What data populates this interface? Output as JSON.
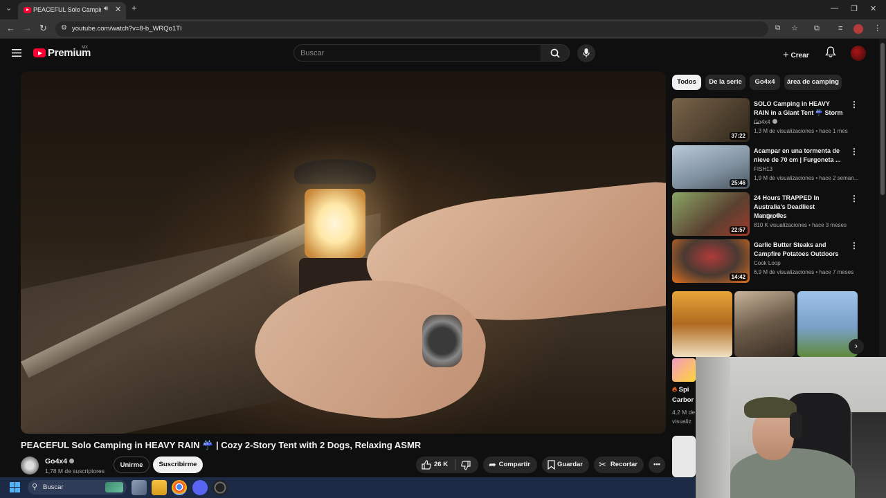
{
  "browser": {
    "tab_title": "PEACEFUL Solo Camping in HEAVY RAIN",
    "url": "youtube.com/watch?v=8-b_WRQo1TI"
  },
  "header": {
    "logo_text": "Premium",
    "country_code": "MX",
    "search_placeholder": "Buscar",
    "create_label": "Crear"
  },
  "video": {
    "title": "PEACEFUL Solo Camping in HEAVY RAIN ☔ | Cozy 2-Story Tent with 2 Dogs, Relaxing ASMR",
    "channel": "Go4x4",
    "subscribers": "1,78 M de suscriptores",
    "join_label": "Unirme",
    "subscribe_label": "Suscribirme",
    "likes": "26 K",
    "share_label": "Compartir",
    "save_label": "Guardar",
    "clip_label": "Recortar"
  },
  "chips": [
    "Todos",
    "De la serie",
    "Go4x4",
    "área de camping"
  ],
  "recommendations": [
    {
      "title": "SOLO Camping in HEAVY RAIN in a Giant Tent ☔ Storm ...",
      "channel": "Go4x4",
      "verified": true,
      "meta": "1,3 M de visualizaciones • hace 1 mes",
      "duration": "37:22",
      "color": "#5a4a36"
    },
    {
      "title": "Acampar en una tormenta de nieve de 70 cm | Furgoneta ...",
      "channel": "FISH13",
      "verified": false,
      "meta": "1,9 M de visualizaciones • hace 2 seman...",
      "duration": "25:46",
      "color": "#8aa0b6"
    },
    {
      "title": "24 Hours TRAPPED In Australia's Deadliest Mangroves",
      "channel": "Nick Fry",
      "verified": true,
      "meta": "810 K visualizaciones • hace 3 meses",
      "duration": "22:57",
      "color": "#6d7a45"
    },
    {
      "title": "Garlic Butter Steaks and Campfire Potatoes Outdoors",
      "channel": "Cook Loop",
      "verified": false,
      "meta": "6,9 M de visualizaciones • hace 7 meses",
      "duration": "14:42",
      "color": "#4a3a30"
    }
  ],
  "shorts_peek": {
    "title_start": "Spi",
    "title_line2": "Carbor",
    "views": "4,2 M de",
    "views_line2": "visualiz"
  },
  "taskbar": {
    "search_label": "Buscar"
  }
}
